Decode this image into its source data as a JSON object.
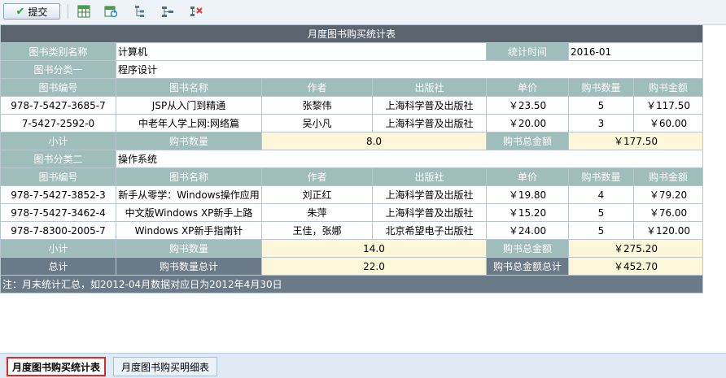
{
  "toolbar": {
    "submit_label": "提交",
    "icons": [
      "excel-export-icon",
      "excel-refresh-icon",
      "tree-structure-icon",
      "indent-icon",
      "delete-icon"
    ]
  },
  "report": {
    "title": "月度图书购买统计表",
    "category_label": "图书类别名称",
    "category_value": "计算机",
    "period_label": "统计时间",
    "period_value": "2016-01",
    "columns": [
      "图书编号",
      "图书名称",
      "作者",
      "出版社",
      "单价",
      "购书数量",
      "购书金额"
    ],
    "groups": [
      {
        "label": "图书分类一",
        "name": "程序设计",
        "rows": [
          [
            "978-7-5427-3685-7",
            "JSP从入门到精通",
            "张黎伟",
            "上海科学普及出版社",
            "￥23.50",
            "5",
            "￥117.50"
          ],
          [
            "7-5427-2592-0",
            "中老年人学上网:网络篇",
            "吴小凡",
            "上海科学普及出版社",
            "￥20.00",
            "3",
            "￥60.00"
          ]
        ],
        "subtotal_label": "小计",
        "qty_label": "购书数量",
        "qty": "8.0",
        "amount_label": "购书总金额",
        "amount": "￥177.50"
      },
      {
        "label": "图书分类二",
        "name": "操作系统",
        "rows": [
          [
            "978-7-5427-3852-3",
            "新手从零学：Windows操作应用",
            "刘正红",
            "上海科学普及出版社",
            "￥19.80",
            "4",
            "￥79.20"
          ],
          [
            "978-7-5427-3462-4",
            "中文版Windows XP新手上路",
            "朱萍",
            "上海科学普及出版社",
            "￥15.20",
            "5",
            "￥76.00"
          ],
          [
            "978-7-8300-2005-7",
            "Windows XP新手指南针",
            "王佳，张娜",
            "北京希望电子出版社",
            "￥24.00",
            "5",
            "￥120.00"
          ]
        ],
        "subtotal_label": "小计",
        "qty_label": "购书数量",
        "qty": "14.0",
        "amount_label": "购书总金额",
        "amount": "￥275.20"
      }
    ],
    "total": {
      "label": "总计",
      "qty_label": "购书数量总计",
      "qty": "22.0",
      "amount_label": "购书总金额总计",
      "amount": "￥452.70"
    },
    "note": "注：月末统计汇总，如2012-04月数据对应日为2012年4月30日"
  },
  "tabs": [
    {
      "label": "月度图书购买统计表",
      "active": true
    },
    {
      "label": "月度图书购买明细表",
      "active": false
    }
  ]
}
